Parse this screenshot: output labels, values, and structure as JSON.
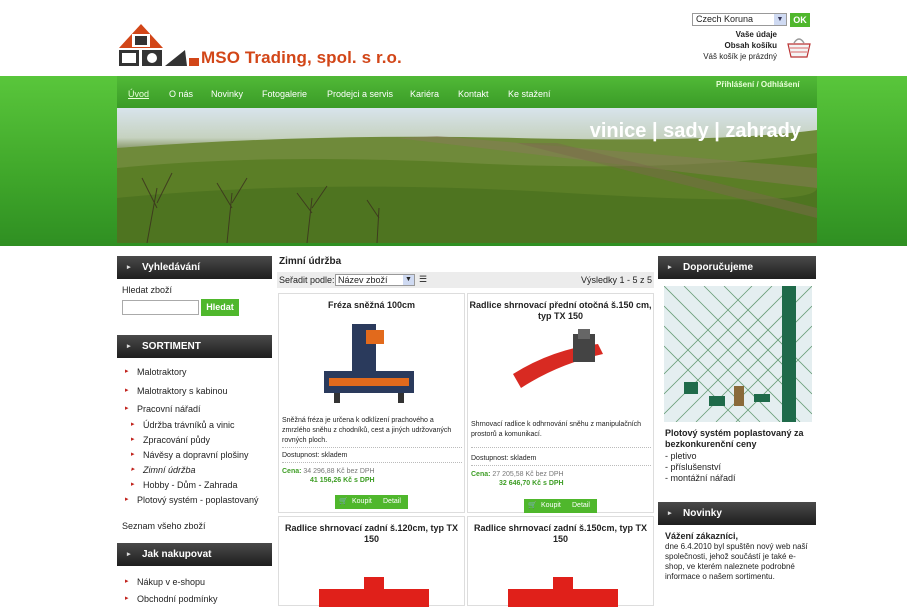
{
  "header": {
    "company": "MSO Trading, spol. s r.o.",
    "currency": "Czech Koruna",
    "ok": "OK",
    "account": [
      "Vaše údaje",
      "Obsah košíku",
      "Váš košík je prázdný"
    ],
    "login": "Přihlášení / Odhlášení"
  },
  "nav": [
    "Úvod",
    "O nás",
    "Novinky",
    "Fotogalerie",
    "Prodejci a servis",
    "Kariéra",
    "Kontakt",
    "Ke stažení"
  ],
  "banner": "vinice | sady | zahrady",
  "search": {
    "title": "Vyhledávání",
    "label": "Hledat zboží",
    "button": "Hledat"
  },
  "sortiment": {
    "title": "SORTIMENT",
    "items": [
      "Malotraktory",
      "Malotraktory s kabinou",
      "Pracovní nářadí"
    ],
    "sub": [
      "Údržba trávníků a vinic",
      "Zpracování půdy",
      "Návěsy a dopravní plošiny",
      "Zimní údržba",
      "Hobby - Dům - Zahrada"
    ],
    "last": "Plotový systém - poplastovaný",
    "all": "Seznam všeho zboží"
  },
  "howto": {
    "title": "Jak nakupovat",
    "items": [
      "Nákup v e-shopu",
      "Obchodní podmínky"
    ]
  },
  "main": {
    "title": "Zimní údržba",
    "sort_label": "Seřadit podle:",
    "sort_value": "Název zboží",
    "results": "Výsledky 1 - 5 z 5"
  },
  "products": [
    {
      "title": "Fréza sněžná 100cm",
      "desc": "Sněžná fréza je určena k odklízení prachového a zmrzlého sněhu z chodníků, cest a jiných udržovaných rovných ploch.",
      "avail": "Dostupnost: skladem",
      "price_label": "Cena:",
      "price_nodph": "34 296,88 Kč bez DPH",
      "price_dph": "41 156,26 Kč s DPH",
      "buy": "Koupit",
      "detail": "Detail"
    },
    {
      "title": "Radlice shrnovací přední otočná š.150 cm, typ TX 150",
      "desc": "Shrnovací radlice k odhrnování sněhu z manipulačních prostorů a komunikací.",
      "avail": "Dostupnost: skladem",
      "price_label": "Cena:",
      "price_nodph": "27 205,58 Kč bez DPH",
      "price_dph": "32 646,70 Kč s DPH",
      "buy": "Koupit",
      "detail": "Detail"
    },
    {
      "title": "Radlice shrnovací zadní š.120cm, typ TX 150"
    },
    {
      "title": "Radlice shrnovací zadní š.150cm, typ TX 150"
    }
  ],
  "recommend": {
    "title": "Doporučujeme",
    "headline": "Plotový systém poplastovaný za bezkonkurenční ceny",
    "items": [
      "- pletivo",
      "- příslušenství",
      "- montážní nářadí"
    ]
  },
  "news": {
    "title": "Novinky",
    "headline": "Vážení zákazníci,",
    "text": "dne 6.4.2010 byl spuštěn nový web naší společnosti, jehož součástí je také e-shop, ve kterém naleznete podrobné informace o našem sortimentu."
  },
  "colors": {
    "accent_green": "#4fb72c",
    "brand_orange": "#d24618",
    "dark_box": "#1e1e1e"
  }
}
